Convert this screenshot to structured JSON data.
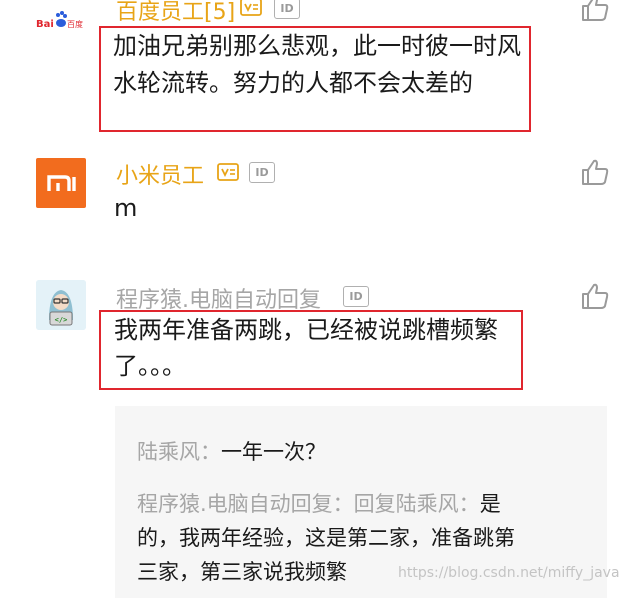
{
  "comments": [
    {
      "user": "百度员工[5]",
      "name_color": "#e8a417",
      "text_lines": [
        "加油兄弟别那么悲观，此一时彼一时风",
        "水轮流转。努力的人都不会太差的"
      ]
    },
    {
      "user": "小米员工",
      "name_color": "#e8a417",
      "text_lines": [
        "m"
      ]
    },
    {
      "user": "程序猿.电脑自动回复",
      "name_color": "#a6a6a6",
      "text_lines": [
        "我两年准备两跳，已经被说跳槽频繁",
        "了。。。"
      ]
    }
  ],
  "badges": {
    "verified_icon": "verified-v-icon",
    "id_label": "ID"
  },
  "avatars": {
    "baidu_logo": "Bai百度",
    "mi_logo": "mi",
    "coder_icon": "</>"
  },
  "reply_panel": {
    "reply1_user": "陆乘风：",
    "reply1_text": "一年一次？",
    "reply2_user": "程序猿.电脑自动回复：回复陆乘风：",
    "reply2_text_a": "是",
    "reply2_line2": "的，我两年经验，这是第二家，准备跳第",
    "reply2_line3": "三家，第三家说我频繁"
  },
  "watermark": "https://blog.csdn.net/miffy_java",
  "colors": {
    "highlight_red": "#e0262e",
    "mi_orange": "#f26c1e",
    "gold": "#e8a417",
    "gray": "#a6a6a6"
  }
}
